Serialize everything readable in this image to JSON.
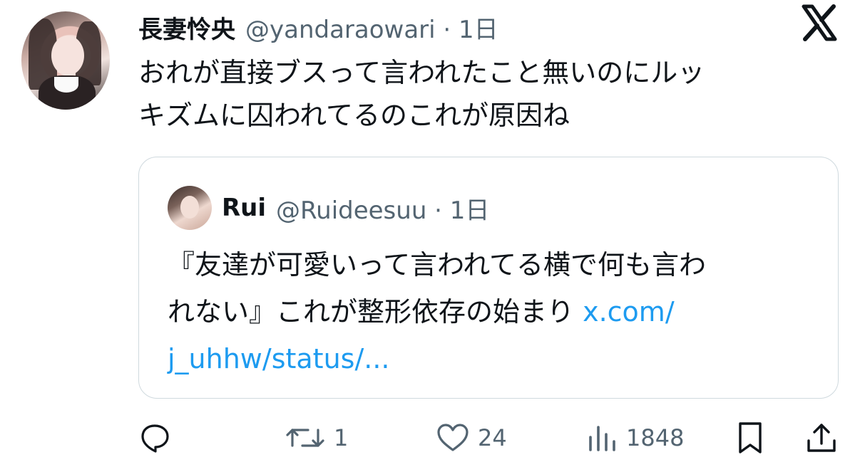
{
  "tweet": {
    "display_name": "長妻怜央",
    "handle_line": "@yandaraowari · 1日",
    "text_lines": [
      "おれが直接ブスって言われたこと無いのにルッ",
      "キズムに囚われてるのこれが原因ね"
    ]
  },
  "quote": {
    "display_name": "Rui",
    "handle_line": "@Ruideesuu · 1日",
    "line1": "『友達が可愛いって言われてる横で何も言わ",
    "line2_text": "れない』これが整形依存の始まり ",
    "line2_link": "x.com/",
    "line3_link": "j_uhhw/status/..."
  },
  "actions": {
    "reply_icon": "reply-icon",
    "retweet_icon": "retweet-icon",
    "retweet_count": "1",
    "like_icon": "heart-icon",
    "like_count": "24",
    "views_icon": "views-icon",
    "views_count": "1848",
    "bookmark_icon": "bookmark-icon",
    "share_icon": "share-icon"
  },
  "colors": {
    "text": "#0f1419",
    "secondary": "#536471",
    "link": "#1d9bf0",
    "border": "#cfd9de"
  }
}
